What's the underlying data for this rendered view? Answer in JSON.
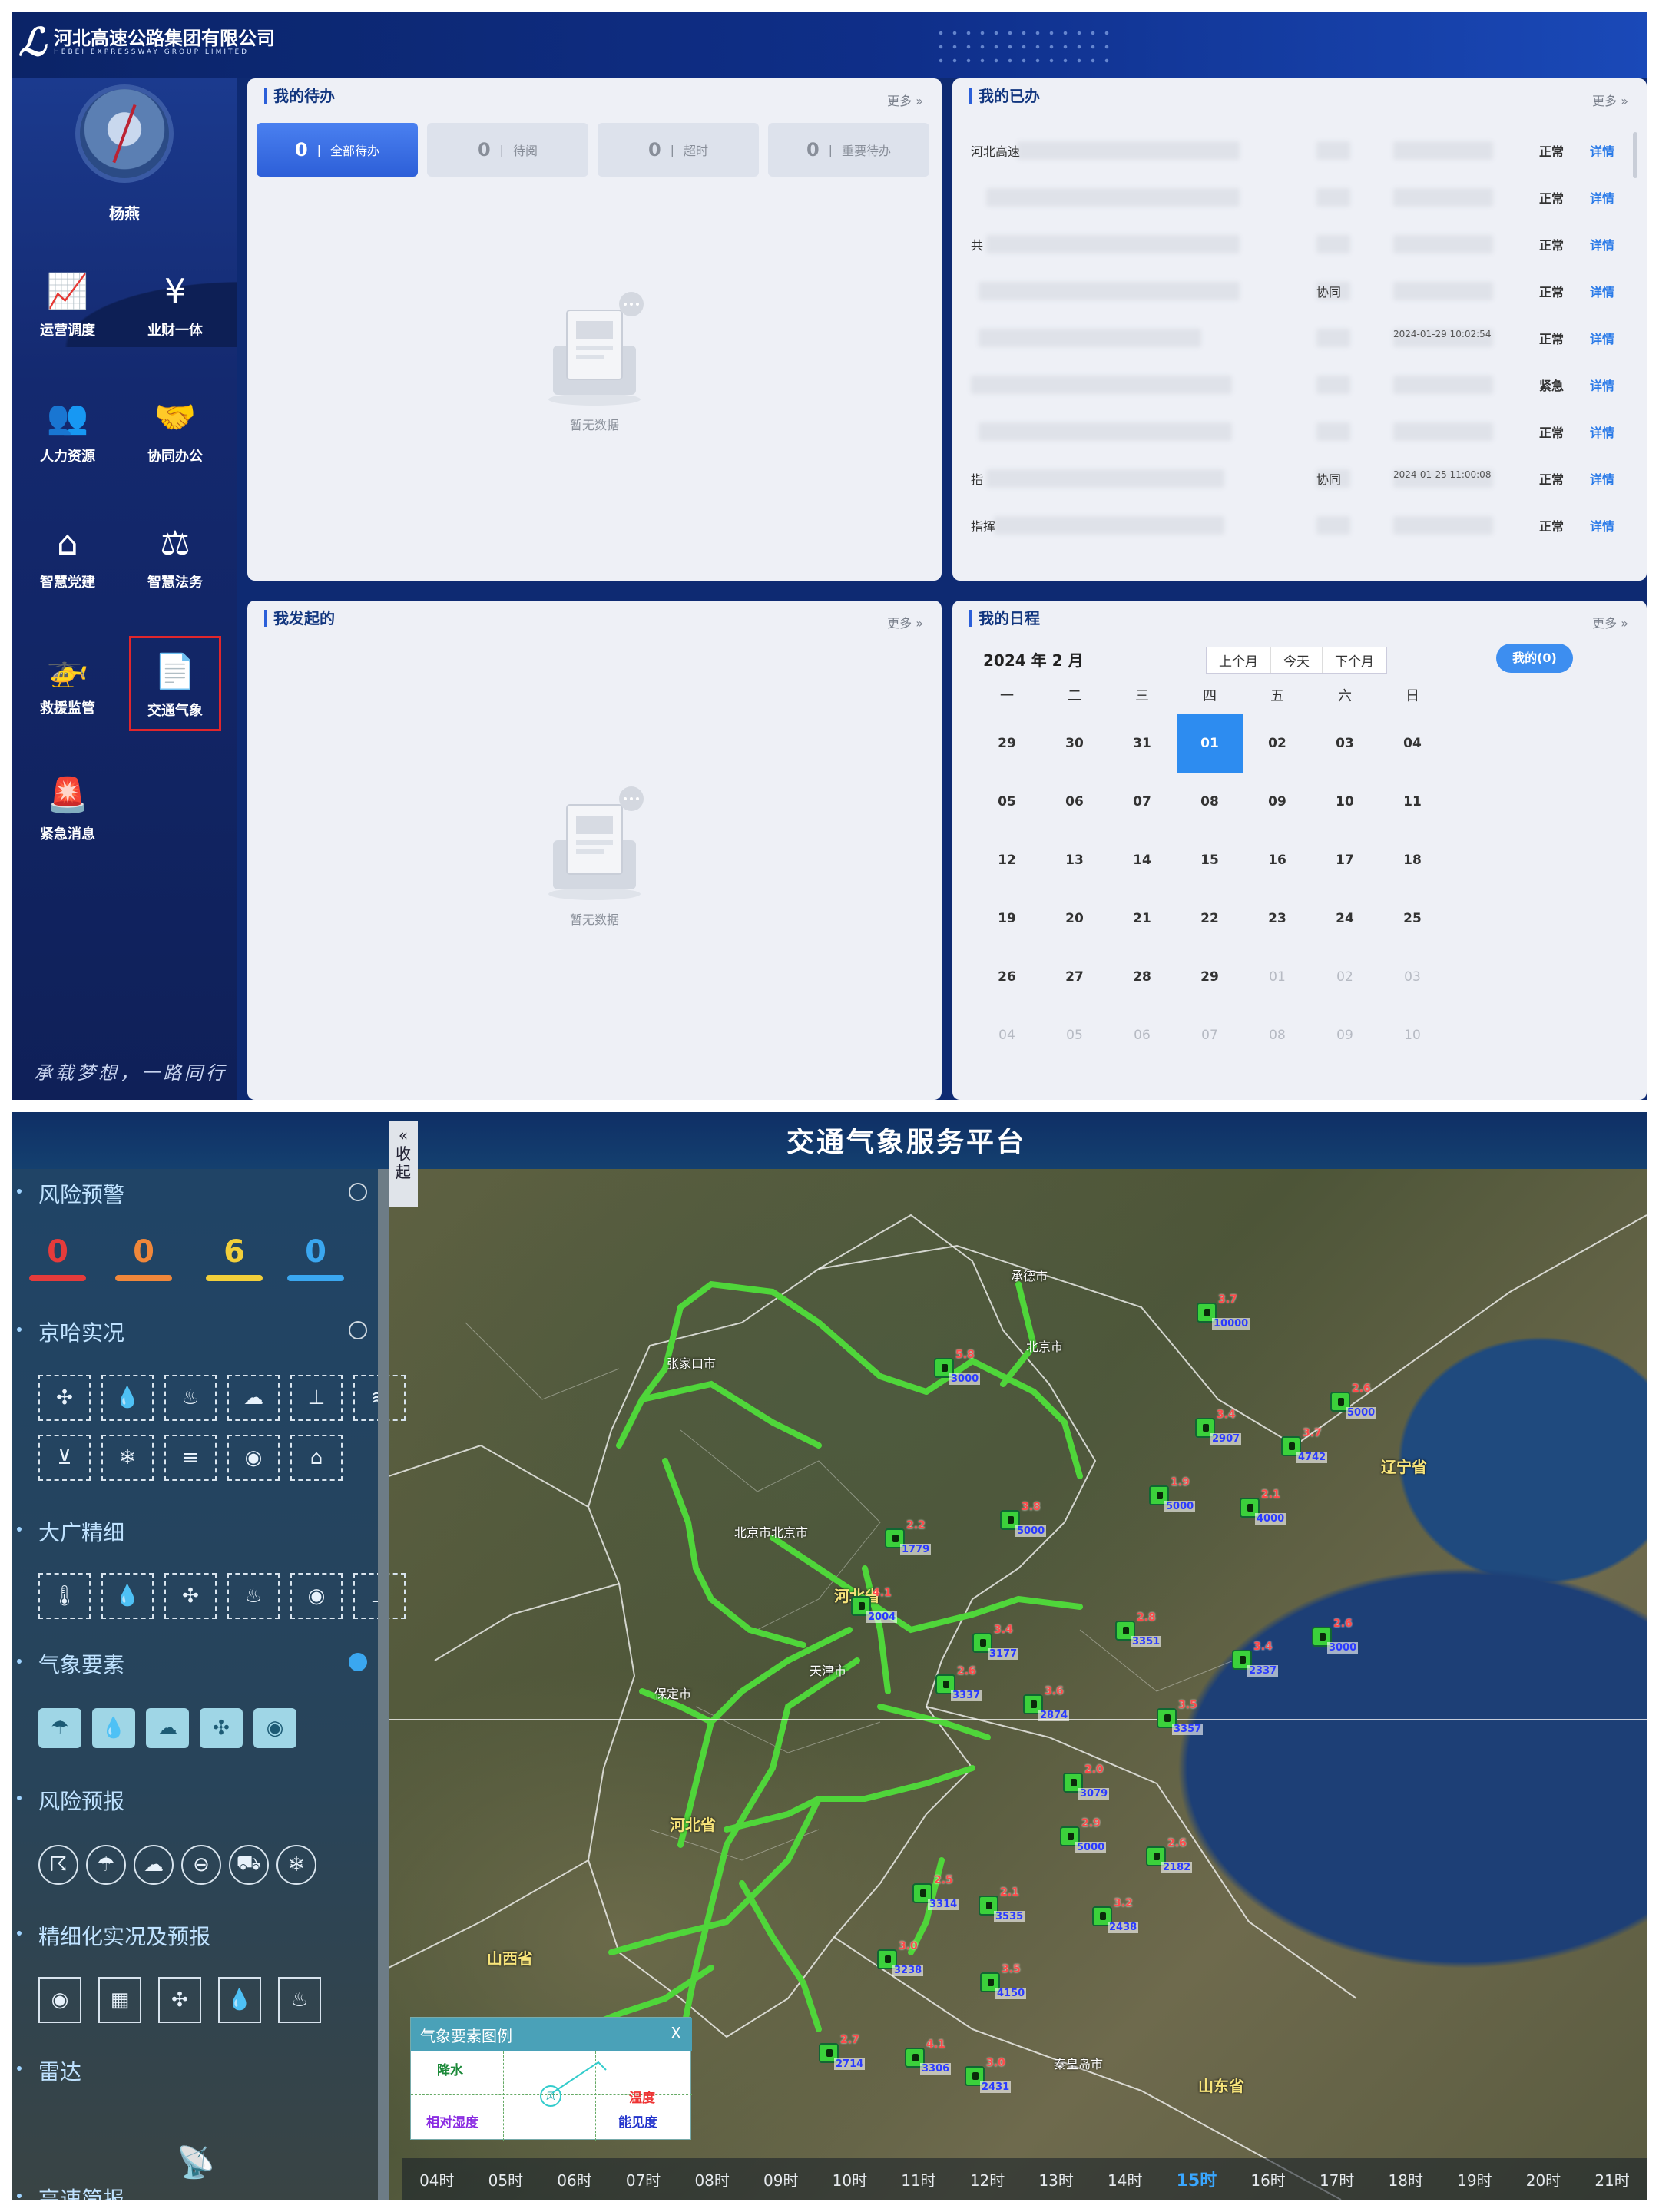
{
  "portal": {
    "company_name": "河北高速公路集团有限公司",
    "company_name_en": "HEBEI EXPRESSWAY GROUP LIMITED",
    "user": {
      "name": "杨燕"
    },
    "nav": [
      {
        "label": "运营调度",
        "icon": "chart-icon"
      },
      {
        "label": "业财一体",
        "icon": "folder-yen-icon"
      },
      {
        "label": "人力资源",
        "icon": "people-icon"
      },
      {
        "label": "协同办公",
        "icon": "handshake-icon"
      },
      {
        "label": "智慧党建",
        "icon": "house-star-icon"
      },
      {
        "label": "智慧法务",
        "icon": "scales-icon"
      },
      {
        "label": "救援监管",
        "icon": "helicopter-icon"
      },
      {
        "label": "交通气象",
        "icon": "document-weather-icon",
        "active": true
      },
      {
        "label": "紧急消息",
        "icon": "alarm-icon"
      }
    ],
    "slogan": "承载梦想，一路同行",
    "todo": {
      "title": "我的待办",
      "more": "更多 »",
      "tabs": [
        {
          "count": "0",
          "label": "全部待办",
          "active": true
        },
        {
          "count": "0",
          "label": "待阅"
        },
        {
          "count": "0",
          "label": "超时"
        },
        {
          "count": "0",
          "label": "重要待办"
        }
      ],
      "empty": "暂无数据"
    },
    "done": {
      "title": "我的已办",
      "more": "更多 »",
      "rows": [
        {
          "c1": "河北高速",
          "c2": "",
          "c3": "",
          "status": "正常",
          "detail": "详情"
        },
        {
          "c1": "",
          "c2": "",
          "c3": "",
          "status": "正常",
          "detail": "详情"
        },
        {
          "c1": "共",
          "c2": "",
          "c3": "",
          "status": "正常",
          "detail": "详情"
        },
        {
          "c1": "",
          "c2": "协同",
          "c3": "",
          "status": "正常",
          "detail": "详情"
        },
        {
          "c1": "",
          "c2": "",
          "c3": "2024-01-29 10:02:54",
          "status": "正常",
          "detail": "详情"
        },
        {
          "c1": "",
          "c2": "",
          "c3": "",
          "status": "紧急",
          "detail": "详情"
        },
        {
          "c1": "",
          "c2": "",
          "c3": "",
          "status": "正常",
          "detail": "详情"
        },
        {
          "c1": "指",
          "c2": "协同",
          "c3": "2024-01-25 11:00:08",
          "status": "正常",
          "detail": "详情"
        },
        {
          "c1": "指挥",
          "c2": "",
          "c3": "",
          "status": "正常",
          "detail": "详情"
        }
      ]
    },
    "initiated": {
      "title": "我发起的",
      "more": "更多 »",
      "empty": "暂无数据"
    },
    "schedule": {
      "title": "我的日程",
      "more": "更多 »",
      "month_label": "2024 年 2 月",
      "btn_prev": "上个月",
      "btn_today": "今天",
      "btn_next": "下个月",
      "mine_btn": "我的(0)",
      "weekdays": [
        "一",
        "二",
        "三",
        "四",
        "五",
        "六",
        "日"
      ],
      "weeks": [
        [
          {
            "d": "29",
            "dim": false
          },
          {
            "d": "30",
            "dim": false
          },
          {
            "d": "31",
            "dim": false
          },
          {
            "d": "01",
            "today": true
          },
          {
            "d": "02"
          },
          {
            "d": "03"
          },
          {
            "d": "04"
          }
        ],
        [
          {
            "d": "05"
          },
          {
            "d": "06"
          },
          {
            "d": "07"
          },
          {
            "d": "08"
          },
          {
            "d": "09"
          },
          {
            "d": "10"
          },
          {
            "d": "11"
          }
        ],
        [
          {
            "d": "12"
          },
          {
            "d": "13"
          },
          {
            "d": "14"
          },
          {
            "d": "15"
          },
          {
            "d": "16"
          },
          {
            "d": "17"
          },
          {
            "d": "18"
          }
        ],
        [
          {
            "d": "19"
          },
          {
            "d": "20"
          },
          {
            "d": "21"
          },
          {
            "d": "22"
          },
          {
            "d": "23"
          },
          {
            "d": "24"
          },
          {
            "d": "25"
          }
        ],
        [
          {
            "d": "26"
          },
          {
            "d": "27"
          },
          {
            "d": "28"
          },
          {
            "d": "29"
          },
          {
            "d": "01",
            "dim": true
          },
          {
            "d": "02",
            "dim": true
          },
          {
            "d": "03",
            "dim": true
          }
        ],
        [
          {
            "d": "04",
            "dim": true
          },
          {
            "d": "05",
            "dim": true
          },
          {
            "d": "06",
            "dim": true
          },
          {
            "d": "07",
            "dim": true
          },
          {
            "d": "08",
            "dim": true
          },
          {
            "d": "09",
            "dim": true
          },
          {
            "d": "10",
            "dim": true
          }
        ]
      ]
    }
  },
  "weather": {
    "title": "交通气象服务平台",
    "collapse": "收起",
    "collapse_arrow": "«",
    "sections": {
      "risk_warning": "风险预警",
      "jingha": "京哈实况",
      "daguang": "大广精细",
      "elements": "气象要素",
      "risk_forecast": "风险预报",
      "fine": "精细化实况及预报",
      "radar": "雷达",
      "highway": "高速简报"
    },
    "warnings": [
      {
        "value": "0",
        "color": "#e53b3b"
      },
      {
        "value": "0",
        "color": "#f0873a"
      },
      {
        "value": "6",
        "color": "#f2cf3a"
      },
      {
        "value": "0",
        "color": "#3aa7f0"
      }
    ],
    "regions": [
      "张家口市",
      "北京市",
      "北京市北京市",
      "河北省",
      "天津市",
      "河北省",
      "山西省",
      "山东省",
      "辽宁省",
      "保定市",
      "承德市",
      "秦皇岛市"
    ],
    "legend": {
      "title": "气象要素图例",
      "close": "X",
      "precip": "降水",
      "temp": "温度",
      "humidity": "相对湿度",
      "visibility": "能见度",
      "center": "风"
    },
    "hours": [
      "04时",
      "05时",
      "06时",
      "07时",
      "08时",
      "09时",
      "10时",
      "11时",
      "12时",
      "13时",
      "14时",
      "15时",
      "16时",
      "17时",
      "18时",
      "19时",
      "20时",
      "21时"
    ],
    "selected_hour": "15时",
    "stations": [
      {
        "v": "3.7",
        "vis": "10000"
      },
      {
        "v": "2.6",
        "vis": "5000"
      },
      {
        "v": "5.8",
        "vis": "3000"
      },
      {
        "v": "3.4",
        "vis": "2907"
      },
      {
        "v": "3.7",
        "vis": "4742"
      },
      {
        "v": "1.9",
        "vis": "5000"
      },
      {
        "v": "2.2",
        "vis": "1779"
      },
      {
        "v": "3.8",
        "vis": "5000"
      },
      {
        "v": "2.1",
        "vis": "4000"
      },
      {
        "v": "4.1",
        "vis": "2004"
      },
      {
        "v": "3.4",
        "vis": "3177"
      },
      {
        "v": "2.8",
        "vis": "3351"
      },
      {
        "v": "3.4",
        "vis": "2337"
      },
      {
        "v": "2.6",
        "vis": "3000"
      },
      {
        "v": "2.6",
        "vis": "3337"
      },
      {
        "v": "3.6",
        "vis": "2874"
      },
      {
        "v": "3.5",
        "vis": "3357"
      },
      {
        "v": "2.0",
        "vis": "3079"
      },
      {
        "v": "2.9",
        "vis": "5000"
      },
      {
        "v": "2.6",
        "vis": "2182"
      },
      {
        "v": "2.5",
        "vis": "3314"
      },
      {
        "v": "2.1",
        "vis": "3535"
      },
      {
        "v": "3.2",
        "vis": "2438"
      },
      {
        "v": "3.0",
        "vis": "3238"
      },
      {
        "v": "3.5",
        "vis": "4150"
      },
      {
        "v": "2.7",
        "vis": "2714"
      },
      {
        "v": "4.1",
        "vis": "3306"
      },
      {
        "v": "3.0",
        "vis": "2431"
      }
    ]
  }
}
